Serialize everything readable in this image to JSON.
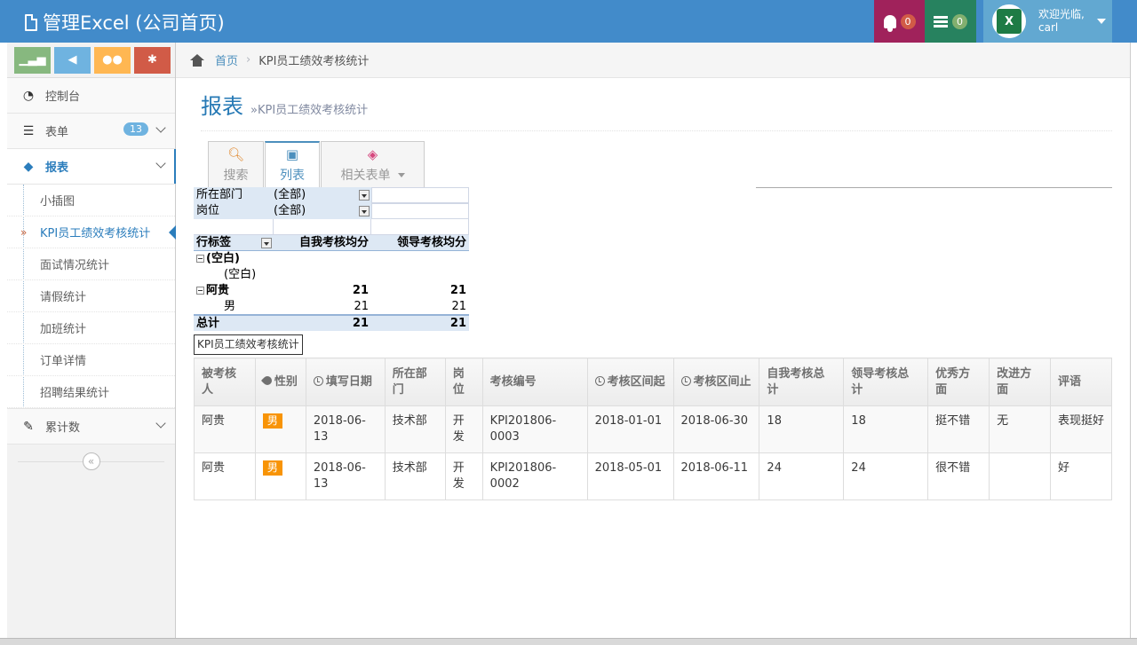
{
  "app": {
    "title": "管理Excel (公司首页)"
  },
  "navbar": {
    "notifications_count": "0",
    "tasks_count": "0",
    "welcome": "欢迎光临,",
    "username": "carl",
    "avatar_letter": "X"
  },
  "sidebar": {
    "items": [
      {
        "label": "控制台",
        "icon": "dashboard-icon"
      },
      {
        "label": "表单",
        "icon": "list-icon",
        "badge": "13"
      },
      {
        "label": "报表",
        "icon": "tag-icon"
      },
      {
        "label": "累计数",
        "icon": "edit-icon"
      }
    ],
    "submenu": [
      {
        "label": "小插图"
      },
      {
        "label": "KPI员工绩效考核统计"
      },
      {
        "label": "面试情况统计"
      },
      {
        "label": "请假统计"
      },
      {
        "label": "加班统计"
      },
      {
        "label": "订单详情"
      },
      {
        "label": "招聘结果统计"
      }
    ]
  },
  "breadcrumb": {
    "home": "首页",
    "current": "KPI员工绩效考核统计"
  },
  "page": {
    "title": "报表",
    "subtitle": "»KPI员工绩效考核统计"
  },
  "toolbar": {
    "search": "搜索",
    "list": "列表",
    "related": "相关表单"
  },
  "pivot": {
    "filters": [
      {
        "label": "所在部门",
        "value": "(全部)"
      },
      {
        "label": "岗位",
        "value": "(全部)"
      }
    ],
    "header": {
      "row_label": "行标签",
      "col1": "自我考核均分",
      "col2": "领导考核均分"
    },
    "rows": [
      {
        "label": "(空白)",
        "v1": "",
        "v2": ""
      },
      {
        "label": "(空白)",
        "v1": "",
        "v2": ""
      },
      {
        "label": "阿贵",
        "v1": "21",
        "v2": "21"
      },
      {
        "label": "男",
        "v1": "21",
        "v2": "21"
      }
    ],
    "total": {
      "label": "总计",
      "v1": "21",
      "v2": "21"
    },
    "sheet_tab": "KPI员工绩效考核统计"
  },
  "table": {
    "headers": [
      "被考核人",
      "性别",
      "填写日期",
      "所在部门",
      "岗位",
      "考核编号",
      "考核区间起",
      "考核区间止",
      "自我考核总计",
      "领导考核总计",
      "优秀方面",
      "改进方面",
      "评语"
    ],
    "rows": [
      [
        "阿贵",
        "男",
        "2018-06-13",
        "技术部",
        "开发",
        "KPI201806-0003",
        "2018-01-01",
        "2018-06-30",
        "18",
        "18",
        "挺不错",
        "无",
        "表现挺好"
      ],
      [
        "阿贵",
        "男",
        "2018-06-13",
        "技术部",
        "开发",
        "KPI201806-0002",
        "2018-05-01",
        "2018-06-11",
        "24",
        "24",
        "很不错",
        "",
        "好"
      ]
    ]
  },
  "colors": {
    "navbar": "#428bca",
    "accent": "#2b7dbc",
    "bell": "#a0225b",
    "tasks": "#27825f",
    "user": "#62a8d1"
  }
}
